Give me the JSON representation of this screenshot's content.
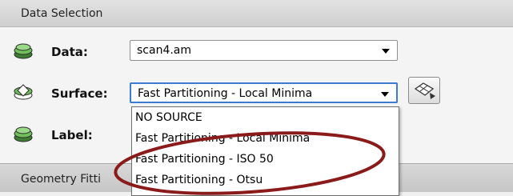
{
  "panel": {
    "title": "Data Selection"
  },
  "data_row": {
    "label": "Data:",
    "value": "scan4.am"
  },
  "surface_row": {
    "label": "Surface:",
    "value": "Fast Partitioning - Local Minima"
  },
  "label_row": {
    "label": "Label:"
  },
  "geometry_section": {
    "title": "Geometry Fitti"
  },
  "surface_dropdown": {
    "options": [
      "NO SOURCE",
      "Fast Partitioning - Local Minima",
      "Fast Partitioning - ISO 50",
      "Fast Partitioning - Otsu"
    ]
  },
  "colors": {
    "annotation_ellipse": "#8b1a1a",
    "focus_border": "#3a7bd5",
    "icon_green": "#4a9a3a"
  },
  "icons": {
    "data": "layer-stack-icon",
    "surface": "surface-stack-icon",
    "label": "layer-stack-icon",
    "tool": "mesh-tool-icon"
  }
}
